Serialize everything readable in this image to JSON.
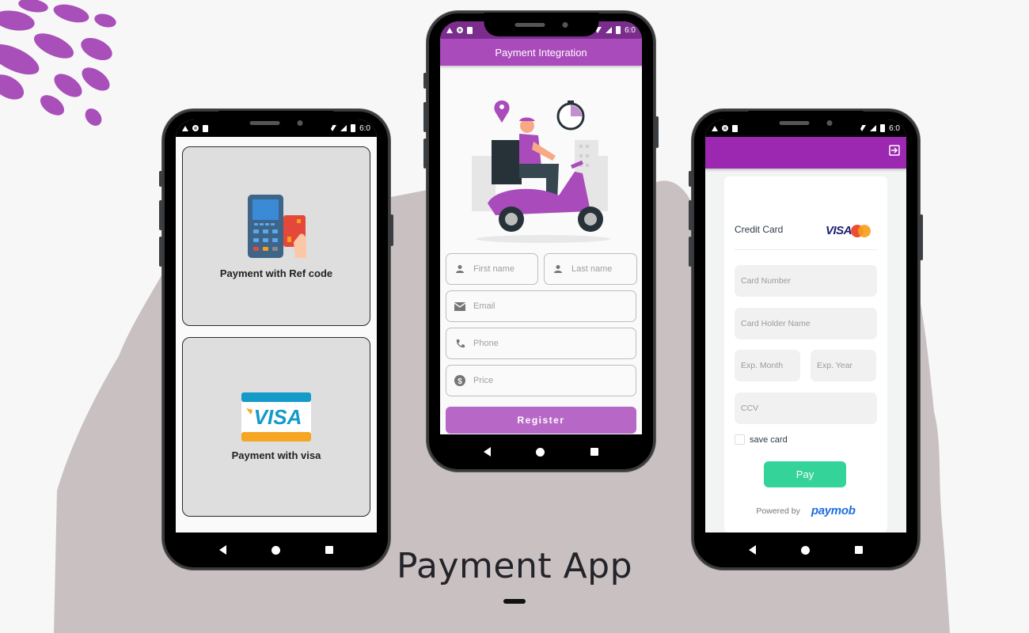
{
  "page": {
    "caption": "Payment App",
    "colors": {
      "background": "#f7f7f7",
      "blob": "#c9c0c1",
      "accent_purple": "#a94bbb",
      "appbar_purple": "#9c27b0",
      "register_button": "#b768c7",
      "pay_button": "#34d399",
      "paymob_blue": "#1f6fe0"
    }
  },
  "status_bar": {
    "time": "6:0"
  },
  "phone1": {
    "cards": [
      {
        "label": "Payment with Ref code",
        "icon": "pos-terminal-icon"
      },
      {
        "label": "Payment with visa",
        "icon": "visa-card-icon"
      }
    ],
    "visa_text": "VISA"
  },
  "phone2": {
    "title": "Payment Integration",
    "illustration": "delivery-scooter-illustration",
    "fields": {
      "first_name": {
        "placeholder": "First name",
        "value": ""
      },
      "last_name": {
        "placeholder": "Last name",
        "value": ""
      },
      "email": {
        "placeholder": "Email",
        "value": ""
      },
      "phone": {
        "placeholder": "Phone",
        "value": ""
      },
      "price": {
        "placeholder": "Price",
        "value": ""
      }
    },
    "register_label": "Register"
  },
  "phone3": {
    "section_title": "Credit Card",
    "visa_logo": "VISA",
    "fields": {
      "card_number": "Card Number",
      "card_holder": "Card Holder Name",
      "exp_month": "Exp. Month",
      "exp_year": "Exp. Year",
      "ccv": "CCV"
    },
    "save_card_label": "save card",
    "save_card_checked": false,
    "pay_label": "Pay",
    "powered_by": "Powered by",
    "provider": "paymob"
  }
}
